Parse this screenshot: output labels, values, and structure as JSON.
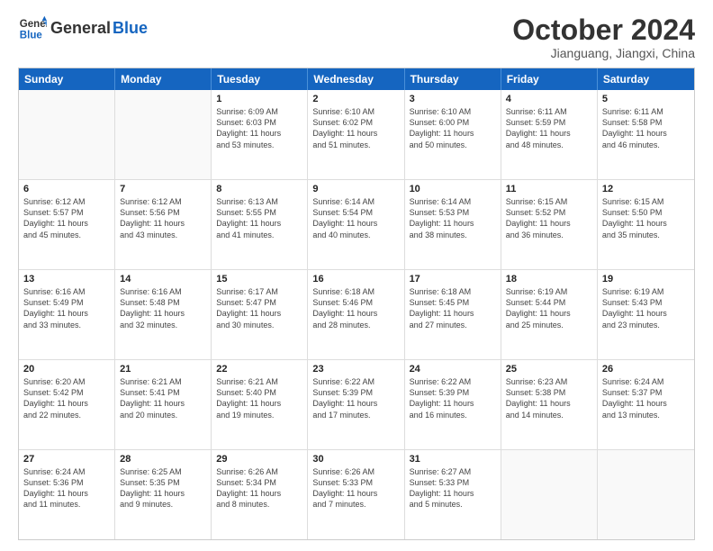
{
  "header": {
    "logo_general": "General",
    "logo_blue": "Blue",
    "month_title": "October 2024",
    "location": "Jianguang, Jiangxi, China"
  },
  "weekdays": [
    "Sunday",
    "Monday",
    "Tuesday",
    "Wednesday",
    "Thursday",
    "Friday",
    "Saturday"
  ],
  "rows": [
    [
      {
        "day": "",
        "info": ""
      },
      {
        "day": "",
        "info": ""
      },
      {
        "day": "1",
        "info": "Sunrise: 6:09 AM\nSunset: 6:03 PM\nDaylight: 11 hours\nand 53 minutes."
      },
      {
        "day": "2",
        "info": "Sunrise: 6:10 AM\nSunset: 6:02 PM\nDaylight: 11 hours\nand 51 minutes."
      },
      {
        "day": "3",
        "info": "Sunrise: 6:10 AM\nSunset: 6:00 PM\nDaylight: 11 hours\nand 50 minutes."
      },
      {
        "day": "4",
        "info": "Sunrise: 6:11 AM\nSunset: 5:59 PM\nDaylight: 11 hours\nand 48 minutes."
      },
      {
        "day": "5",
        "info": "Sunrise: 6:11 AM\nSunset: 5:58 PM\nDaylight: 11 hours\nand 46 minutes."
      }
    ],
    [
      {
        "day": "6",
        "info": "Sunrise: 6:12 AM\nSunset: 5:57 PM\nDaylight: 11 hours\nand 45 minutes."
      },
      {
        "day": "7",
        "info": "Sunrise: 6:12 AM\nSunset: 5:56 PM\nDaylight: 11 hours\nand 43 minutes."
      },
      {
        "day": "8",
        "info": "Sunrise: 6:13 AM\nSunset: 5:55 PM\nDaylight: 11 hours\nand 41 minutes."
      },
      {
        "day": "9",
        "info": "Sunrise: 6:14 AM\nSunset: 5:54 PM\nDaylight: 11 hours\nand 40 minutes."
      },
      {
        "day": "10",
        "info": "Sunrise: 6:14 AM\nSunset: 5:53 PM\nDaylight: 11 hours\nand 38 minutes."
      },
      {
        "day": "11",
        "info": "Sunrise: 6:15 AM\nSunset: 5:52 PM\nDaylight: 11 hours\nand 36 minutes."
      },
      {
        "day": "12",
        "info": "Sunrise: 6:15 AM\nSunset: 5:50 PM\nDaylight: 11 hours\nand 35 minutes."
      }
    ],
    [
      {
        "day": "13",
        "info": "Sunrise: 6:16 AM\nSunset: 5:49 PM\nDaylight: 11 hours\nand 33 minutes."
      },
      {
        "day": "14",
        "info": "Sunrise: 6:16 AM\nSunset: 5:48 PM\nDaylight: 11 hours\nand 32 minutes."
      },
      {
        "day": "15",
        "info": "Sunrise: 6:17 AM\nSunset: 5:47 PM\nDaylight: 11 hours\nand 30 minutes."
      },
      {
        "day": "16",
        "info": "Sunrise: 6:18 AM\nSunset: 5:46 PM\nDaylight: 11 hours\nand 28 minutes."
      },
      {
        "day": "17",
        "info": "Sunrise: 6:18 AM\nSunset: 5:45 PM\nDaylight: 11 hours\nand 27 minutes."
      },
      {
        "day": "18",
        "info": "Sunrise: 6:19 AM\nSunset: 5:44 PM\nDaylight: 11 hours\nand 25 minutes."
      },
      {
        "day": "19",
        "info": "Sunrise: 6:19 AM\nSunset: 5:43 PM\nDaylight: 11 hours\nand 23 minutes."
      }
    ],
    [
      {
        "day": "20",
        "info": "Sunrise: 6:20 AM\nSunset: 5:42 PM\nDaylight: 11 hours\nand 22 minutes."
      },
      {
        "day": "21",
        "info": "Sunrise: 6:21 AM\nSunset: 5:41 PM\nDaylight: 11 hours\nand 20 minutes."
      },
      {
        "day": "22",
        "info": "Sunrise: 6:21 AM\nSunset: 5:40 PM\nDaylight: 11 hours\nand 19 minutes."
      },
      {
        "day": "23",
        "info": "Sunrise: 6:22 AM\nSunset: 5:39 PM\nDaylight: 11 hours\nand 17 minutes."
      },
      {
        "day": "24",
        "info": "Sunrise: 6:22 AM\nSunset: 5:39 PM\nDaylight: 11 hours\nand 16 minutes."
      },
      {
        "day": "25",
        "info": "Sunrise: 6:23 AM\nSunset: 5:38 PM\nDaylight: 11 hours\nand 14 minutes."
      },
      {
        "day": "26",
        "info": "Sunrise: 6:24 AM\nSunset: 5:37 PM\nDaylight: 11 hours\nand 13 minutes."
      }
    ],
    [
      {
        "day": "27",
        "info": "Sunrise: 6:24 AM\nSunset: 5:36 PM\nDaylight: 11 hours\nand 11 minutes."
      },
      {
        "day": "28",
        "info": "Sunrise: 6:25 AM\nSunset: 5:35 PM\nDaylight: 11 hours\nand 9 minutes."
      },
      {
        "day": "29",
        "info": "Sunrise: 6:26 AM\nSunset: 5:34 PM\nDaylight: 11 hours\nand 8 minutes."
      },
      {
        "day": "30",
        "info": "Sunrise: 6:26 AM\nSunset: 5:33 PM\nDaylight: 11 hours\nand 7 minutes."
      },
      {
        "day": "31",
        "info": "Sunrise: 6:27 AM\nSunset: 5:33 PM\nDaylight: 11 hours\nand 5 minutes."
      },
      {
        "day": "",
        "info": ""
      },
      {
        "day": "",
        "info": ""
      }
    ]
  ]
}
